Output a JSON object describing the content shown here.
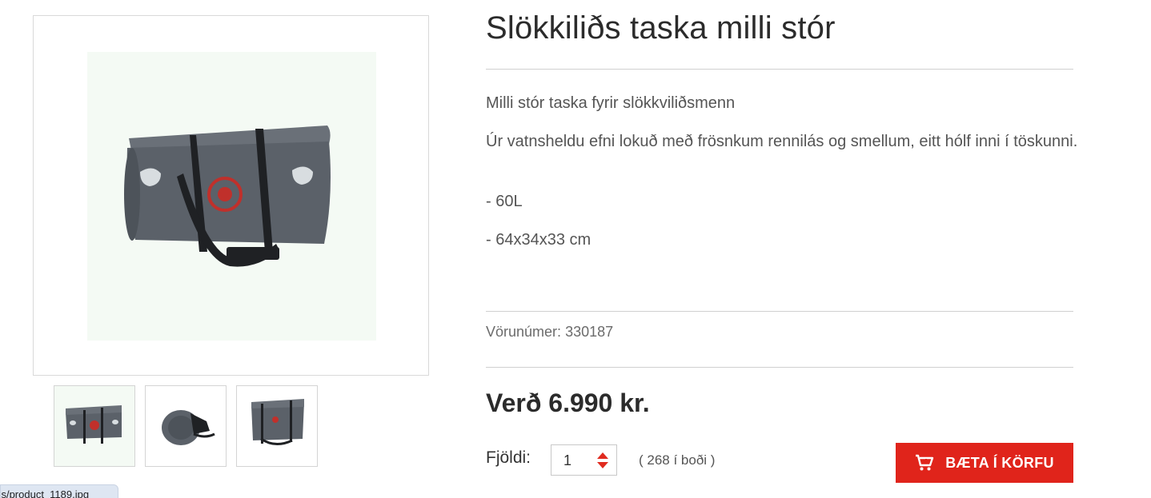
{
  "product": {
    "title": "Slökkiliðs taska milli stór",
    "description_lines": [
      "Milli stór taska fyrir slökkviliðsmenn",
      "Úr vatnsheldu efni lokuð með frösnkum rennilás og smellum, eitt hólf inni í töskunni.",
      "- 60L",
      "- 64x34x33  cm"
    ],
    "sku_label": "Vörunúmer:",
    "sku_value": "330187",
    "price": "Verð 6.990 kr."
  },
  "purchase": {
    "quantity_label": "Fjöldi:",
    "quantity_value": "1",
    "stock_text": "( 268 í boði )",
    "add_to_cart_label": "BÆTA Í KÖRFU"
  },
  "status_bar": {
    "url_fragment": "ges/product_1189.jpg"
  },
  "icons": {
    "cart": "add-to-cart-icon",
    "qty_up": "caret-up-icon",
    "qty_down": "caret-down-icon"
  },
  "colors": {
    "accent": "#e0241b",
    "bag_body": "#5b6169",
    "image_bg": "#f4faf4"
  }
}
